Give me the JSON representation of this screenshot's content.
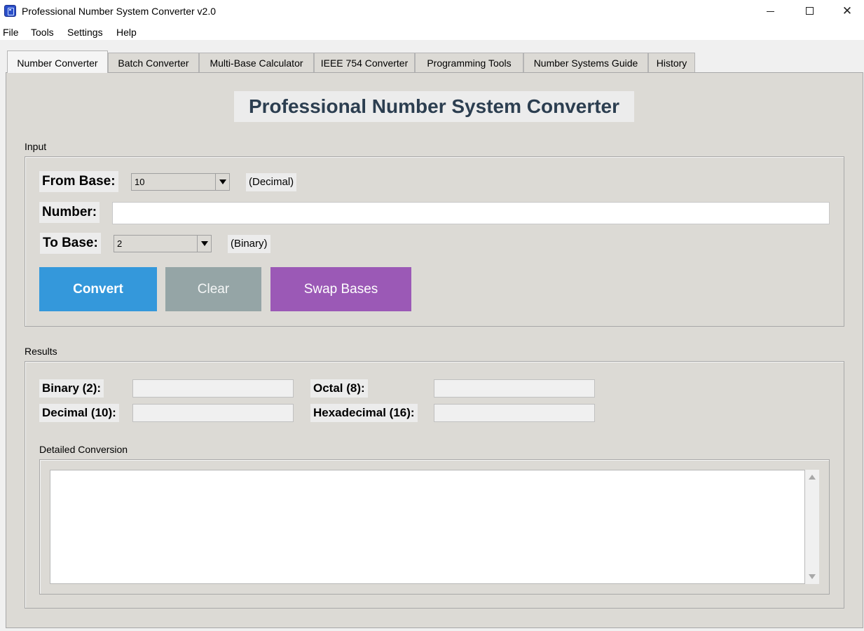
{
  "window": {
    "title": "Professional Number System Converter v2.0",
    "icon": "app-icon",
    "controls": {
      "minimize": "minimize-icon",
      "maximize": "maximize-icon",
      "close": "✕"
    }
  },
  "menu": [
    "File",
    "Tools",
    "Settings",
    "Help"
  ],
  "tabs": [
    "Number Converter",
    "Batch Converter",
    "Multi-Base Calculator",
    "IEEE 754 Converter",
    "Programming Tools",
    "Number Systems Guide",
    "History"
  ],
  "active_tab": "Number Converter",
  "heading": "Professional Number System Converter",
  "input": {
    "group_label": "Input",
    "from_base_label": "From Base:",
    "from_base_value": "10",
    "from_base_hint": "(Decimal)",
    "number_label": "Number:",
    "number_value": "",
    "to_base_label": "To Base:",
    "to_base_value": "2",
    "to_base_hint": "(Binary)"
  },
  "buttons": {
    "convert": "Convert",
    "clear": "Clear",
    "swap": "Swap Bases"
  },
  "results": {
    "group_label": "Results",
    "binary_label": "Binary (2):",
    "binary_value": "",
    "octal_label": "Octal (8):",
    "octal_value": "",
    "decimal_label": "Decimal (10):",
    "decimal_value": "",
    "hex_label": "Hexadecimal (16):",
    "hex_value": "",
    "detail_label": "Detailed Conversion",
    "detail_text": ""
  },
  "colors": {
    "convert": "#3498db",
    "clear": "#95a5a6",
    "swap": "#9b59b6",
    "heading": "#2c3e50",
    "panel": "#dcdad5"
  }
}
